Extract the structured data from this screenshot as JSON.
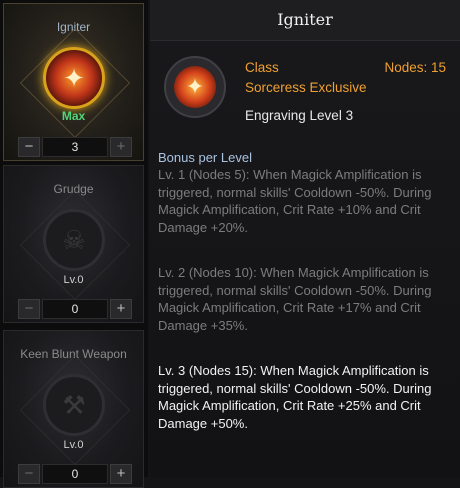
{
  "engravings": [
    {
      "name": "Igniter",
      "level": "Max",
      "value": "3",
      "active": true
    },
    {
      "name": "Grudge",
      "level": "Lv.0",
      "value": "0",
      "active": false
    },
    {
      "name": "Keen Blunt Weapon",
      "level": "Lv.0",
      "value": "0",
      "active": false
    }
  ],
  "stepper": {
    "minus": "−",
    "plus": "+"
  },
  "detail": {
    "title": "Igniter",
    "class_label": "Class",
    "nodes": "Nodes: 15",
    "class_name": "Sorceress Exclusive",
    "engraving_level": "Engraving Level 3",
    "bonus_heading": "Bonus per Level",
    "levels": [
      "Lv. 1 (Nodes 5): When Magick Amplification is triggered, normal skills' Cooldown -50%. During Magick Amplification, Crit Rate +10% and Crit Damage +20%.",
      "Lv. 2 (Nodes 10): When Magick Amplification is triggered, normal skills' Cooldown -50%. During Magick Amplification, Crit Rate +17% and Crit Damage +35%.",
      "Lv. 3 (Nodes 15): When Magick Amplification is triggered, normal skills' Cooldown -50%. During Magick Amplification, Crit Rate +25% and Crit Damage +50%."
    ]
  },
  "colors": {
    "accent": "#f0a030",
    "bonus": "#a9c3e0",
    "max": "#4fd67a"
  },
  "icons": {
    "igniter": "flame-icon",
    "grudge": "skull-icon",
    "keen": "hammer-icon"
  }
}
